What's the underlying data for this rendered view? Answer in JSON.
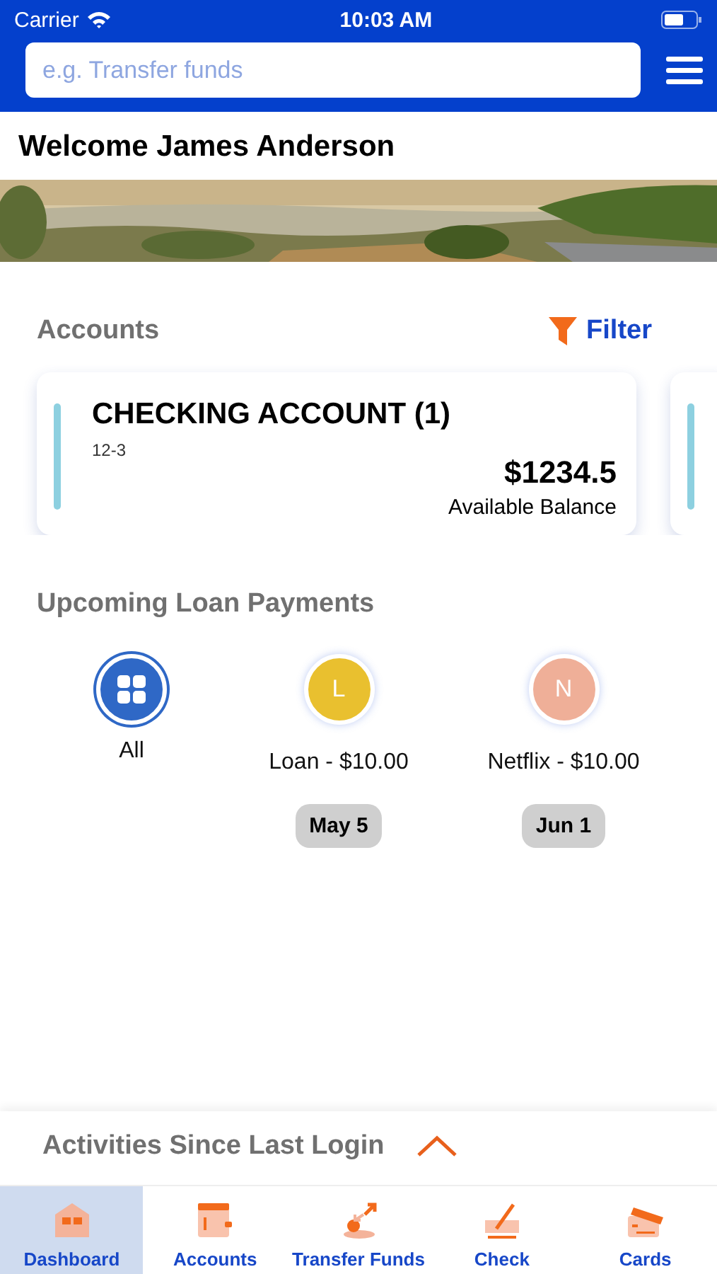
{
  "status_bar": {
    "carrier": "Carrier",
    "time": "10:03 AM"
  },
  "search": {
    "placeholder": "e.g. Transfer funds"
  },
  "welcome": "Welcome James Anderson",
  "accounts": {
    "title": "Accounts",
    "filter": "Filter",
    "cards": [
      {
        "name": "CHECKING ACCOUNT (1)",
        "number": "12-3",
        "balance": "$1234.5",
        "balance_label": "Available Balance"
      }
    ]
  },
  "payments": {
    "title": "Upcoming Loan Payments",
    "items": [
      {
        "kind": "all",
        "label": "All",
        "selected": true
      },
      {
        "kind": "payee",
        "initial": "L",
        "label": "Loan - $10.00",
        "date": "May 5",
        "color": "#e9c02f",
        "selected": false
      },
      {
        "kind": "payee",
        "initial": "N",
        "label": "Netflix - $10.00",
        "date": "Jun 1",
        "color": "#efaf98",
        "selected": false
      }
    ]
  },
  "activities": {
    "title": "Activities Since Last Login",
    "expanded": false
  },
  "tabs": [
    {
      "label": "Dashboard",
      "selected": true
    },
    {
      "label": "Accounts",
      "selected": false
    },
    {
      "label": "Transfer Funds",
      "selected": false
    },
    {
      "label": "Check",
      "selected": false
    },
    {
      "label": "Cards",
      "selected": false
    }
  ]
}
